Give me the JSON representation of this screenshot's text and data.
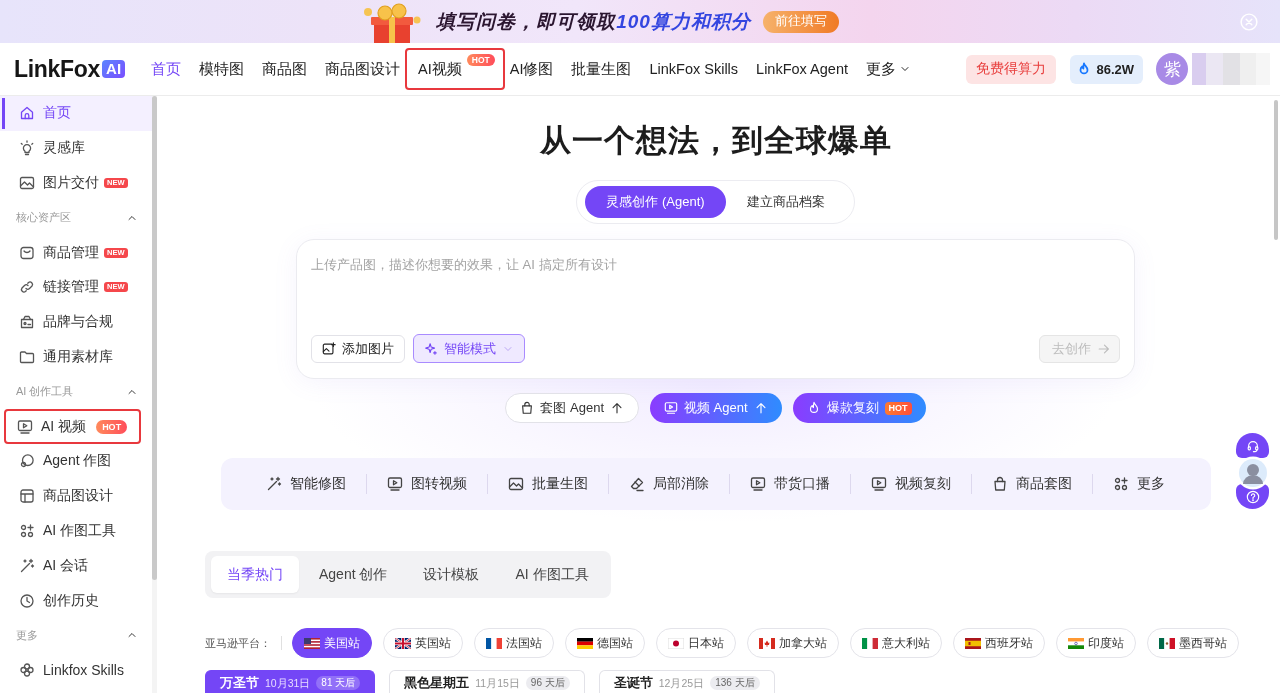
{
  "banner": {
    "headline": "填写问卷，即可领取",
    "highlight": "100算力和积分",
    "button": "前往填写"
  },
  "header": {
    "logo": {
      "wordmark": "LinkFox",
      "badge": "AI"
    },
    "nav": [
      {
        "kind": "link",
        "label": "首页",
        "selected": true,
        "outlined": false
      },
      {
        "kind": "link",
        "label": "模特图",
        "selected": false,
        "outlined": false
      },
      {
        "kind": "link",
        "label": "商品图",
        "selected": false,
        "outlined": false
      },
      {
        "kind": "link",
        "label": "商品图设计",
        "selected": false,
        "outlined": false
      },
      {
        "kind": "link",
        "label": "AI视频",
        "selected": false,
        "outlined": true,
        "badge": {
          "text": "HOT",
          "kind": "hot"
        }
      },
      {
        "kind": "link",
        "label": "AI修图",
        "selected": false,
        "outlined": false
      },
      {
        "kind": "link",
        "label": "批量生图",
        "selected": false,
        "outlined": false
      },
      {
        "kind": "link",
        "label": "LinkFox Skills",
        "selected": false,
        "outlined": false
      },
      {
        "kind": "link",
        "label": "LinkFox Agent",
        "selected": false,
        "outlined": false
      },
      {
        "kind": "menu",
        "label": "更多",
        "selected": false,
        "outlined": false
      }
    ],
    "account": {
      "credits_button": "免费得算力",
      "balance": "86.2W",
      "avatar": "紫"
    }
  },
  "sidebar": {
    "items": [
      {
        "kind": "item",
        "label": "首页",
        "selected": true,
        "outlined": false
      },
      {
        "kind": "item",
        "label": "灵感库",
        "selected": false,
        "outlined": false
      },
      {
        "kind": "item",
        "label": "图片交付",
        "selected": false,
        "outlined": false,
        "badge": {
          "text": "NEW",
          "kind": "new"
        }
      },
      {
        "kind": "section",
        "label": "核心资产区",
        "expanded": true
      },
      {
        "kind": "item",
        "label": "商品管理",
        "selected": false,
        "outlined": false,
        "badge": {
          "text": "NEW",
          "kind": "new"
        }
      },
      {
        "kind": "item",
        "label": "链接管理",
        "selected": false,
        "outlined": false,
        "badge": {
          "text": "NEW",
          "kind": "new"
        }
      },
      {
        "kind": "item",
        "label": "品牌与合规",
        "selected": false,
        "outlined": false
      },
      {
        "kind": "item",
        "label": "通用素材库",
        "selected": false,
        "outlined": false
      },
      {
        "kind": "section",
        "label": "AI 创作工具",
        "expanded": true
      },
      {
        "kind": "item",
        "label": "AI 视频",
        "selected": false,
        "outlined": true,
        "badge": {
          "text": "HOT",
          "kind": "hot"
        }
      },
      {
        "kind": "item",
        "label": "Agent 作图",
        "selected": false,
        "outlined": false
      },
      {
        "kind": "item",
        "label": "商品图设计",
        "selected": false,
        "outlined": false
      },
      {
        "kind": "item",
        "label": "AI 作图工具",
        "selected": false,
        "outlined": false
      },
      {
        "kind": "item",
        "label": "AI 会话",
        "selected": false,
        "outlined": false
      },
      {
        "kind": "item",
        "label": "创作历史",
        "selected": false,
        "outlined": false
      },
      {
        "kind": "section",
        "label": "更多",
        "expanded": true
      },
      {
        "kind": "item",
        "label": "Linkfox Skills",
        "selected": false,
        "outlined": false
      }
    ]
  },
  "hero": {
    "title": "从一个想法，到全球爆单"
  },
  "mode_tabs": [
    {
      "label": "灵感创作 (Agent)",
      "selected": true
    },
    {
      "label": "建立商品档案",
      "selected": false
    }
  ],
  "prompt": {
    "placeholder": "上传产品图，描述你想要的效果，让 AI 搞定所有设计",
    "add_image": "添加图片",
    "mode": "智能模式",
    "submit": {
      "label": "去创作",
      "disabled": true
    }
  },
  "agents": [
    {
      "kind": "plain",
      "label": "套图 Agent"
    },
    {
      "kind": "primary",
      "label": "视频 Agent"
    },
    {
      "kind": "hot",
      "label": "爆款复刻",
      "badge": "HOT"
    }
  ],
  "tools": [
    "智能修图",
    "图转视频",
    "批量生图",
    "局部消除",
    "带货口播",
    "视频复刻",
    "商品套图",
    "更多"
  ],
  "category_tabs": [
    {
      "label": "当季热门",
      "selected": true
    },
    {
      "label": "Agent 创作",
      "selected": false
    },
    {
      "label": "设计模板",
      "selected": false
    },
    {
      "label": "AI 作图工具",
      "selected": false
    }
  ],
  "platform_filter": {
    "label": "亚马逊平台：",
    "sites": [
      {
        "label": "美国站",
        "selected": true
      },
      {
        "label": "英国站",
        "selected": false
      },
      {
        "label": "法国站",
        "selected": false
      },
      {
        "label": "德国站",
        "selected": false
      },
      {
        "label": "日本站",
        "selected": false
      },
      {
        "label": "加拿大站",
        "selected": false
      },
      {
        "label": "意大利站",
        "selected": false
      },
      {
        "label": "西班牙站",
        "selected": false
      },
      {
        "label": "印度站",
        "selected": false
      },
      {
        "label": "墨西哥站",
        "selected": false
      }
    ]
  },
  "holidays": [
    {
      "name": "万圣节",
      "date": "10月31日",
      "countdown": "81 天后",
      "selected": true
    },
    {
      "name": "黑色星期五",
      "date": "11月15日",
      "countdown": "96 天后",
      "selected": false
    },
    {
      "name": "圣诞节",
      "date": "12月25日",
      "countdown": "136 天后",
      "selected": false
    }
  ]
}
